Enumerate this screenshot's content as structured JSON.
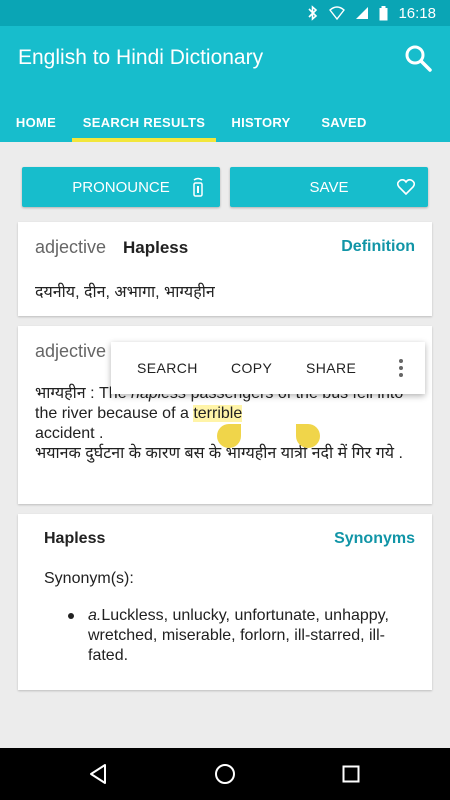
{
  "status_bar": {
    "time": "16:18",
    "icons": [
      "bluetooth-icon",
      "wifi-icon",
      "signal-icon",
      "battery-icon"
    ]
  },
  "app_bar": {
    "title": "English to Hindi Dictionary",
    "search_icon": "search-icon"
  },
  "tabs": [
    {
      "label": "HOME",
      "active": false
    },
    {
      "label": "SEARCH RESULTS",
      "active": true
    },
    {
      "label": "HISTORY",
      "active": false
    },
    {
      "label": "SAVED",
      "active": false
    }
  ],
  "actions": {
    "pronounce": {
      "label": "PRONOUNCE",
      "icon": "speaker-icon"
    },
    "save": {
      "label": "SAVE",
      "icon": "heart-icon"
    }
  },
  "definition_card": {
    "pos": "adjective",
    "word": "Hapless",
    "section_label": "Definition",
    "hindi": "दयनीय, दीन, अभागा, भाग्यहीन"
  },
  "example_card": {
    "pos": "adjective",
    "example_prefix": "भाग्यहीन : The ",
    "example_italic": "hapless",
    "example_mid": " passengers of the bus fell into the river because of a ",
    "example_highlight": "terrible",
    "example_suffix": " accident .",
    "example_hindi": "भयानक दुर्घटना के कारण बस के भाग्यहीन यात्री नदी में गिर गये ."
  },
  "context_menu": {
    "items": [
      "SEARCH",
      "COPY",
      "SHARE"
    ],
    "more_icon": "more-vert-icon"
  },
  "synonyms_card": {
    "word": "Hapless",
    "section_label": "Synonyms",
    "label": "Synonym(s):",
    "marker": "a.",
    "items": "Luckless, unlucky, unfortunate, unhappy, wretched, miserable, forlorn, ill-starred, ill-fated."
  },
  "nav_bar": {
    "back_icon": "back-icon",
    "home_icon": "home-icon",
    "recents_icon": "recents-icon"
  },
  "colors": {
    "primary": "#17bdcc",
    "status_bar": "#0aa5b5",
    "accent_text": "#1195a7",
    "tab_indicator": "#f2e63b",
    "selection": "#fff4a8",
    "handle": "#f0d54a"
  }
}
